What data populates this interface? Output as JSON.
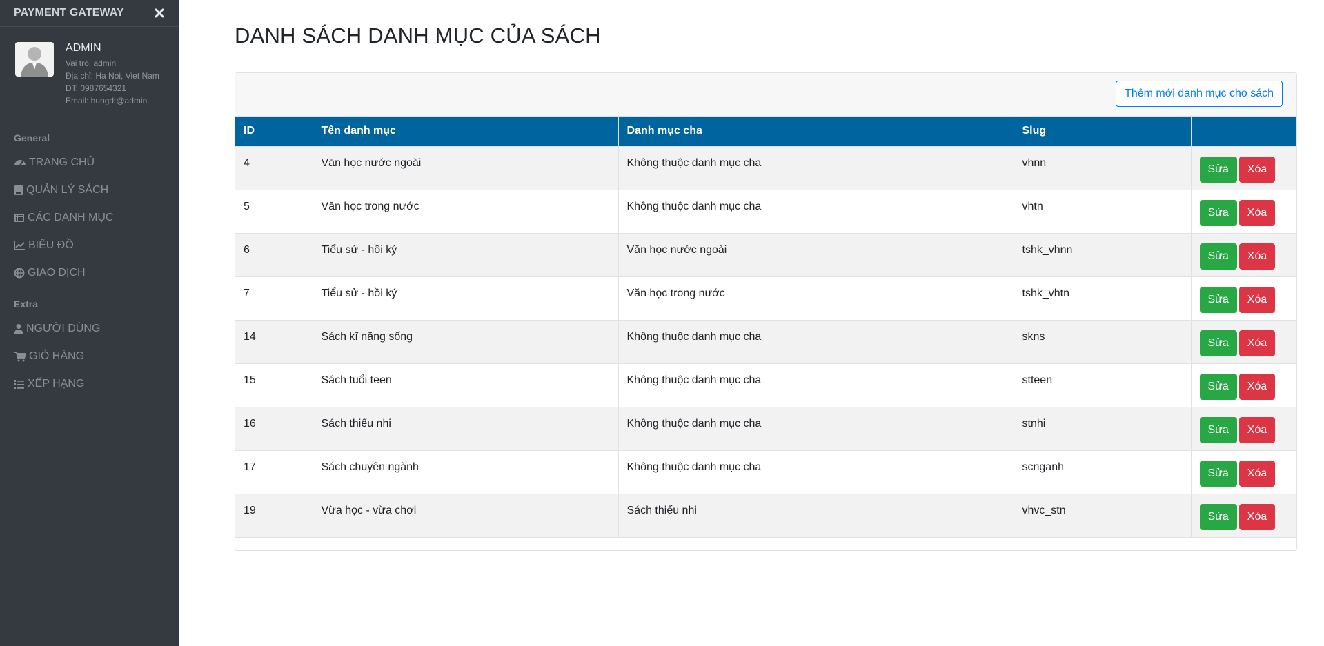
{
  "sidebar": {
    "brand": "PAYMENT GATEWAY",
    "profile": {
      "name": "ADMIN",
      "role": "Vai trò: admin",
      "address": "Địa chỉ: Ha Noi, Viet Nam",
      "phone": "ĐT: 0987654321",
      "email": "Email: hungdt@admin"
    },
    "sections": {
      "general": "General",
      "extra": "Extra"
    },
    "general_items": [
      {
        "label": "TRANG CHỦ",
        "icon": "dashboard-icon"
      },
      {
        "label": "QUẢN LÝ SÁCH",
        "icon": "book-icon"
      },
      {
        "label": "CÁC DANH MỤC",
        "icon": "list-alt-icon"
      },
      {
        "label": "BIỂU ĐỒ",
        "icon": "line-chart-icon"
      },
      {
        "label": "GIAO DỊCH",
        "icon": "globe-icon"
      }
    ],
    "extra_items": [
      {
        "label": "NGƯỜI DÙNG",
        "icon": "user-icon"
      },
      {
        "label": "GIỎ HÀNG",
        "icon": "cart-icon"
      },
      {
        "label": "XẾP HẠNG",
        "icon": "list-ol-icon"
      }
    ]
  },
  "main": {
    "title": "DANH SÁCH DANH MỤC CỦA SÁCH",
    "add_button": "Thêm mới danh mục cho sách",
    "table": {
      "headers": [
        "ID",
        "Tên danh mục",
        "Danh mục cha",
        "Slug",
        ""
      ],
      "rows": [
        {
          "id": "4",
          "name": "Văn học nước ngoài",
          "parent": "Không thuộc danh mục cha",
          "slug": "vhnn"
        },
        {
          "id": "5",
          "name": "Văn học trong nước",
          "parent": "Không thuộc danh mục cha",
          "slug": "vhtn"
        },
        {
          "id": "6",
          "name": "Tiểu sử - hồi ký",
          "parent": "Văn học nước ngoài",
          "slug": "tshk_vhnn"
        },
        {
          "id": "7",
          "name": "Tiểu sử - hồi ký",
          "parent": "Văn học trong nước",
          "slug": "tshk_vhtn"
        },
        {
          "id": "14",
          "name": "Sách kĩ năng sống",
          "parent": "Không thuộc danh mục cha",
          "slug": "skns"
        },
        {
          "id": "15",
          "name": "Sách tuổi teen",
          "parent": "Không thuộc danh mục cha",
          "slug": "stteen"
        },
        {
          "id": "16",
          "name": "Sách thiếu nhi",
          "parent": "Không thuộc danh mục cha",
          "slug": "stnhi"
        },
        {
          "id": "17",
          "name": "Sách chuyên ngành",
          "parent": "Không thuộc danh mục cha",
          "slug": "scnganh"
        },
        {
          "id": "19",
          "name": "Vừa học - vừa chơi",
          "parent": "Sách thiếu nhi",
          "slug": "vhvc_stn"
        }
      ],
      "edit_label": "Sửa",
      "delete_label": "Xóa"
    }
  },
  "colors": {
    "sidebar_bg": "#343a40",
    "table_header": "#00659e",
    "primary": "#007bff",
    "success": "#28a745",
    "danger": "#dc3545"
  }
}
